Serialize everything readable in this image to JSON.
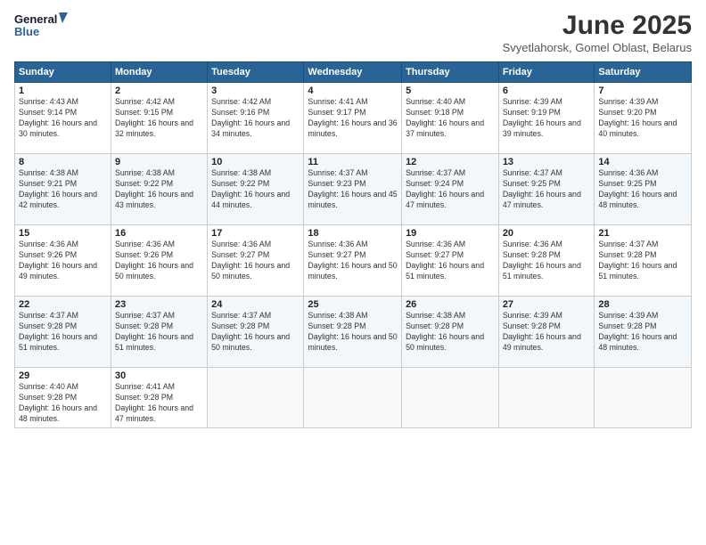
{
  "header": {
    "logo_line1": "General",
    "logo_line2": "Blue",
    "month_title": "June 2025",
    "location": "Svyetlahorsk, Gomel Oblast, Belarus"
  },
  "days_of_week": [
    "Sunday",
    "Monday",
    "Tuesday",
    "Wednesday",
    "Thursday",
    "Friday",
    "Saturday"
  ],
  "weeks": [
    [
      {
        "day": "1",
        "sunrise": "4:43 AM",
        "sunset": "9:14 PM",
        "daylight": "16 hours and 30 minutes."
      },
      {
        "day": "2",
        "sunrise": "4:42 AM",
        "sunset": "9:15 PM",
        "daylight": "16 hours and 32 minutes."
      },
      {
        "day": "3",
        "sunrise": "4:42 AM",
        "sunset": "9:16 PM",
        "daylight": "16 hours and 34 minutes."
      },
      {
        "day": "4",
        "sunrise": "4:41 AM",
        "sunset": "9:17 PM",
        "daylight": "16 hours and 36 minutes."
      },
      {
        "day": "5",
        "sunrise": "4:40 AM",
        "sunset": "9:18 PM",
        "daylight": "16 hours and 37 minutes."
      },
      {
        "day": "6",
        "sunrise": "4:39 AM",
        "sunset": "9:19 PM",
        "daylight": "16 hours and 39 minutes."
      },
      {
        "day": "7",
        "sunrise": "4:39 AM",
        "sunset": "9:20 PM",
        "daylight": "16 hours and 40 minutes."
      }
    ],
    [
      {
        "day": "8",
        "sunrise": "4:38 AM",
        "sunset": "9:21 PM",
        "daylight": "16 hours and 42 minutes."
      },
      {
        "day": "9",
        "sunrise": "4:38 AM",
        "sunset": "9:22 PM",
        "daylight": "16 hours and 43 minutes."
      },
      {
        "day": "10",
        "sunrise": "4:38 AM",
        "sunset": "9:22 PM",
        "daylight": "16 hours and 44 minutes."
      },
      {
        "day": "11",
        "sunrise": "4:37 AM",
        "sunset": "9:23 PM",
        "daylight": "16 hours and 45 minutes."
      },
      {
        "day": "12",
        "sunrise": "4:37 AM",
        "sunset": "9:24 PM",
        "daylight": "16 hours and 47 minutes."
      },
      {
        "day": "13",
        "sunrise": "4:37 AM",
        "sunset": "9:25 PM",
        "daylight": "16 hours and 47 minutes."
      },
      {
        "day": "14",
        "sunrise": "4:36 AM",
        "sunset": "9:25 PM",
        "daylight": "16 hours and 48 minutes."
      }
    ],
    [
      {
        "day": "15",
        "sunrise": "4:36 AM",
        "sunset": "9:26 PM",
        "daylight": "16 hours and 49 minutes."
      },
      {
        "day": "16",
        "sunrise": "4:36 AM",
        "sunset": "9:26 PM",
        "daylight": "16 hours and 50 minutes."
      },
      {
        "day": "17",
        "sunrise": "4:36 AM",
        "sunset": "9:27 PM",
        "daylight": "16 hours and 50 minutes."
      },
      {
        "day": "18",
        "sunrise": "4:36 AM",
        "sunset": "9:27 PM",
        "daylight": "16 hours and 50 minutes."
      },
      {
        "day": "19",
        "sunrise": "4:36 AM",
        "sunset": "9:27 PM",
        "daylight": "16 hours and 51 minutes."
      },
      {
        "day": "20",
        "sunrise": "4:36 AM",
        "sunset": "9:28 PM",
        "daylight": "16 hours and 51 minutes."
      },
      {
        "day": "21",
        "sunrise": "4:37 AM",
        "sunset": "9:28 PM",
        "daylight": "16 hours and 51 minutes."
      }
    ],
    [
      {
        "day": "22",
        "sunrise": "4:37 AM",
        "sunset": "9:28 PM",
        "daylight": "16 hours and 51 minutes."
      },
      {
        "day": "23",
        "sunrise": "4:37 AM",
        "sunset": "9:28 PM",
        "daylight": "16 hours and 51 minutes."
      },
      {
        "day": "24",
        "sunrise": "4:37 AM",
        "sunset": "9:28 PM",
        "daylight": "16 hours and 50 minutes."
      },
      {
        "day": "25",
        "sunrise": "4:38 AM",
        "sunset": "9:28 PM",
        "daylight": "16 hours and 50 minutes."
      },
      {
        "day": "26",
        "sunrise": "4:38 AM",
        "sunset": "9:28 PM",
        "daylight": "16 hours and 50 minutes."
      },
      {
        "day": "27",
        "sunrise": "4:39 AM",
        "sunset": "9:28 PM",
        "daylight": "16 hours and 49 minutes."
      },
      {
        "day": "28",
        "sunrise": "4:39 AM",
        "sunset": "9:28 PM",
        "daylight": "16 hours and 48 minutes."
      }
    ],
    [
      {
        "day": "29",
        "sunrise": "4:40 AM",
        "sunset": "9:28 PM",
        "daylight": "16 hours and 48 minutes."
      },
      {
        "day": "30",
        "sunrise": "4:41 AM",
        "sunset": "9:28 PM",
        "daylight": "16 hours and 47 minutes."
      },
      null,
      null,
      null,
      null,
      null
    ]
  ]
}
